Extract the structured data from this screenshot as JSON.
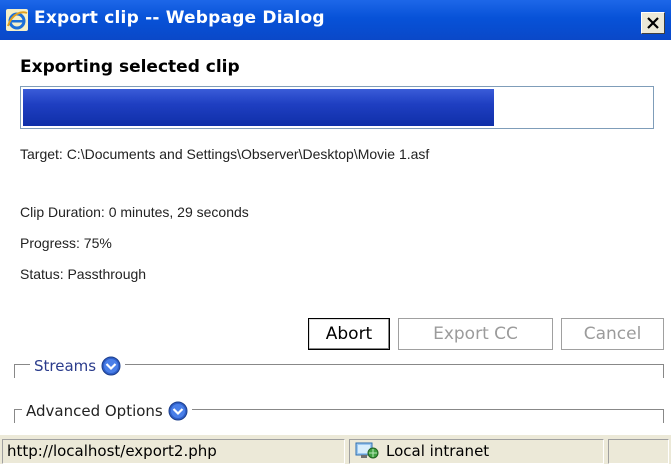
{
  "window": {
    "title": "Export clip -- Webpage Dialog",
    "close_label": "×"
  },
  "dialog": {
    "heading": "Exporting selected clip",
    "progress_value": 0.75,
    "target": "Target: C:\\Documents and Settings\\Observer\\Desktop\\Movie 1.asf",
    "clip_duration": "Clip Duration: 0 minutes, 29  seconds",
    "progress_text": "Progress: 75%",
    "status_text": "Status: Passthrough"
  },
  "buttons": {
    "abort": "Abort",
    "export_cc": "Export CC",
    "cancel": "Cancel"
  },
  "sections": {
    "streams": "Streams",
    "advanced": "Advanced Options"
  },
  "statusbar": {
    "url": "http://localhost/export2.php",
    "zone": "Local intranet"
  },
  "colors": {
    "titlebar": "#0752d8",
    "progress_fill": "#1f3fc2",
    "window_bg": "#ece9d8"
  }
}
